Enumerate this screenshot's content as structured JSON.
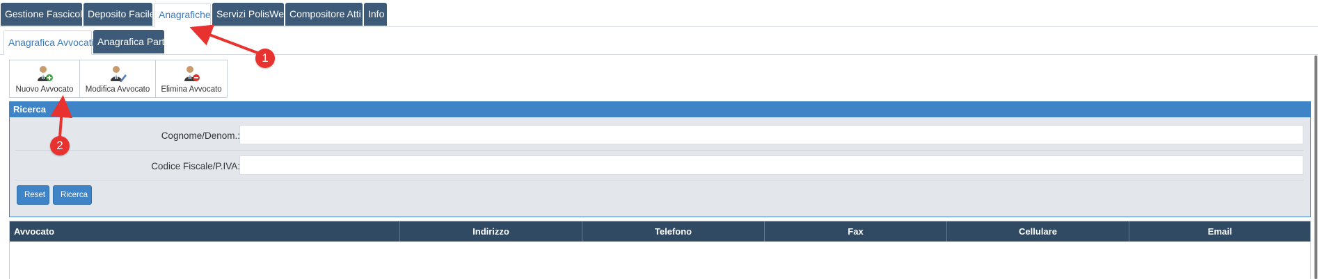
{
  "main_tabs": [
    {
      "label": "Gestione Fascicoli"
    },
    {
      "label": "Deposito Facile"
    },
    {
      "label": "Anagrafiche",
      "active": true
    },
    {
      "label": "Servizi PolisWeb"
    },
    {
      "label": "Compositore Atti"
    },
    {
      "label": "Info"
    }
  ],
  "sub_tabs": [
    {
      "label": "Anagrafica Avvocati",
      "active": true
    },
    {
      "label": "Anagrafica Parti"
    }
  ],
  "toolbar": {
    "new_label": "Nuovo Avvocato",
    "edit_label": "Modifica Avvocato",
    "delete_label": "Elimina Avvocato"
  },
  "search": {
    "title": "Ricerca",
    "surname_label": "Cognome/Denom.:",
    "surname_value": "",
    "taxcode_label": "Codice Fiscale/P.IVA:",
    "taxcode_value": "",
    "reset_label": "Reset",
    "search_label": "Ricerca"
  },
  "table": {
    "columns": [
      "Avvocato",
      "Indirizzo",
      "Telefono",
      "Fax",
      "Cellulare",
      "Email"
    ],
    "rows": []
  },
  "annotations": {
    "step1": "1",
    "step2": "2"
  },
  "colors": {
    "tab_bg": "#3d5a78",
    "accent": "#3f84c6",
    "table_header": "#2f4a62",
    "annotation_red": "#e8322f"
  }
}
